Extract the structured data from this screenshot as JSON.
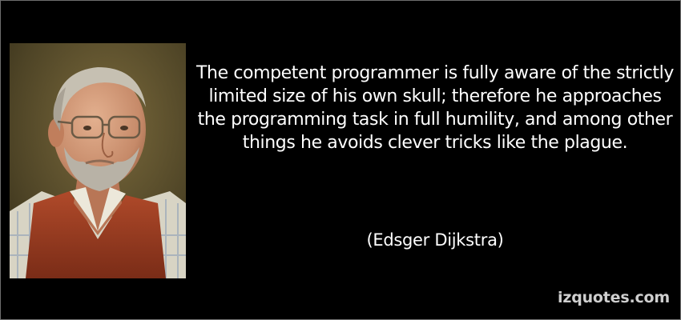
{
  "quote": {
    "text": "The competent programmer is fully aware of the strictly limited size of his own skull; therefore he approaches the programming task in full humility, and among other things he avoids clever tricks like the plague.",
    "author": "(Edsger Dijkstra)"
  },
  "branding": {
    "watermark": "izquotes.com"
  },
  "colors": {
    "background": "#000000",
    "text": "#ffffff",
    "watermark": "#cfcfcf"
  }
}
